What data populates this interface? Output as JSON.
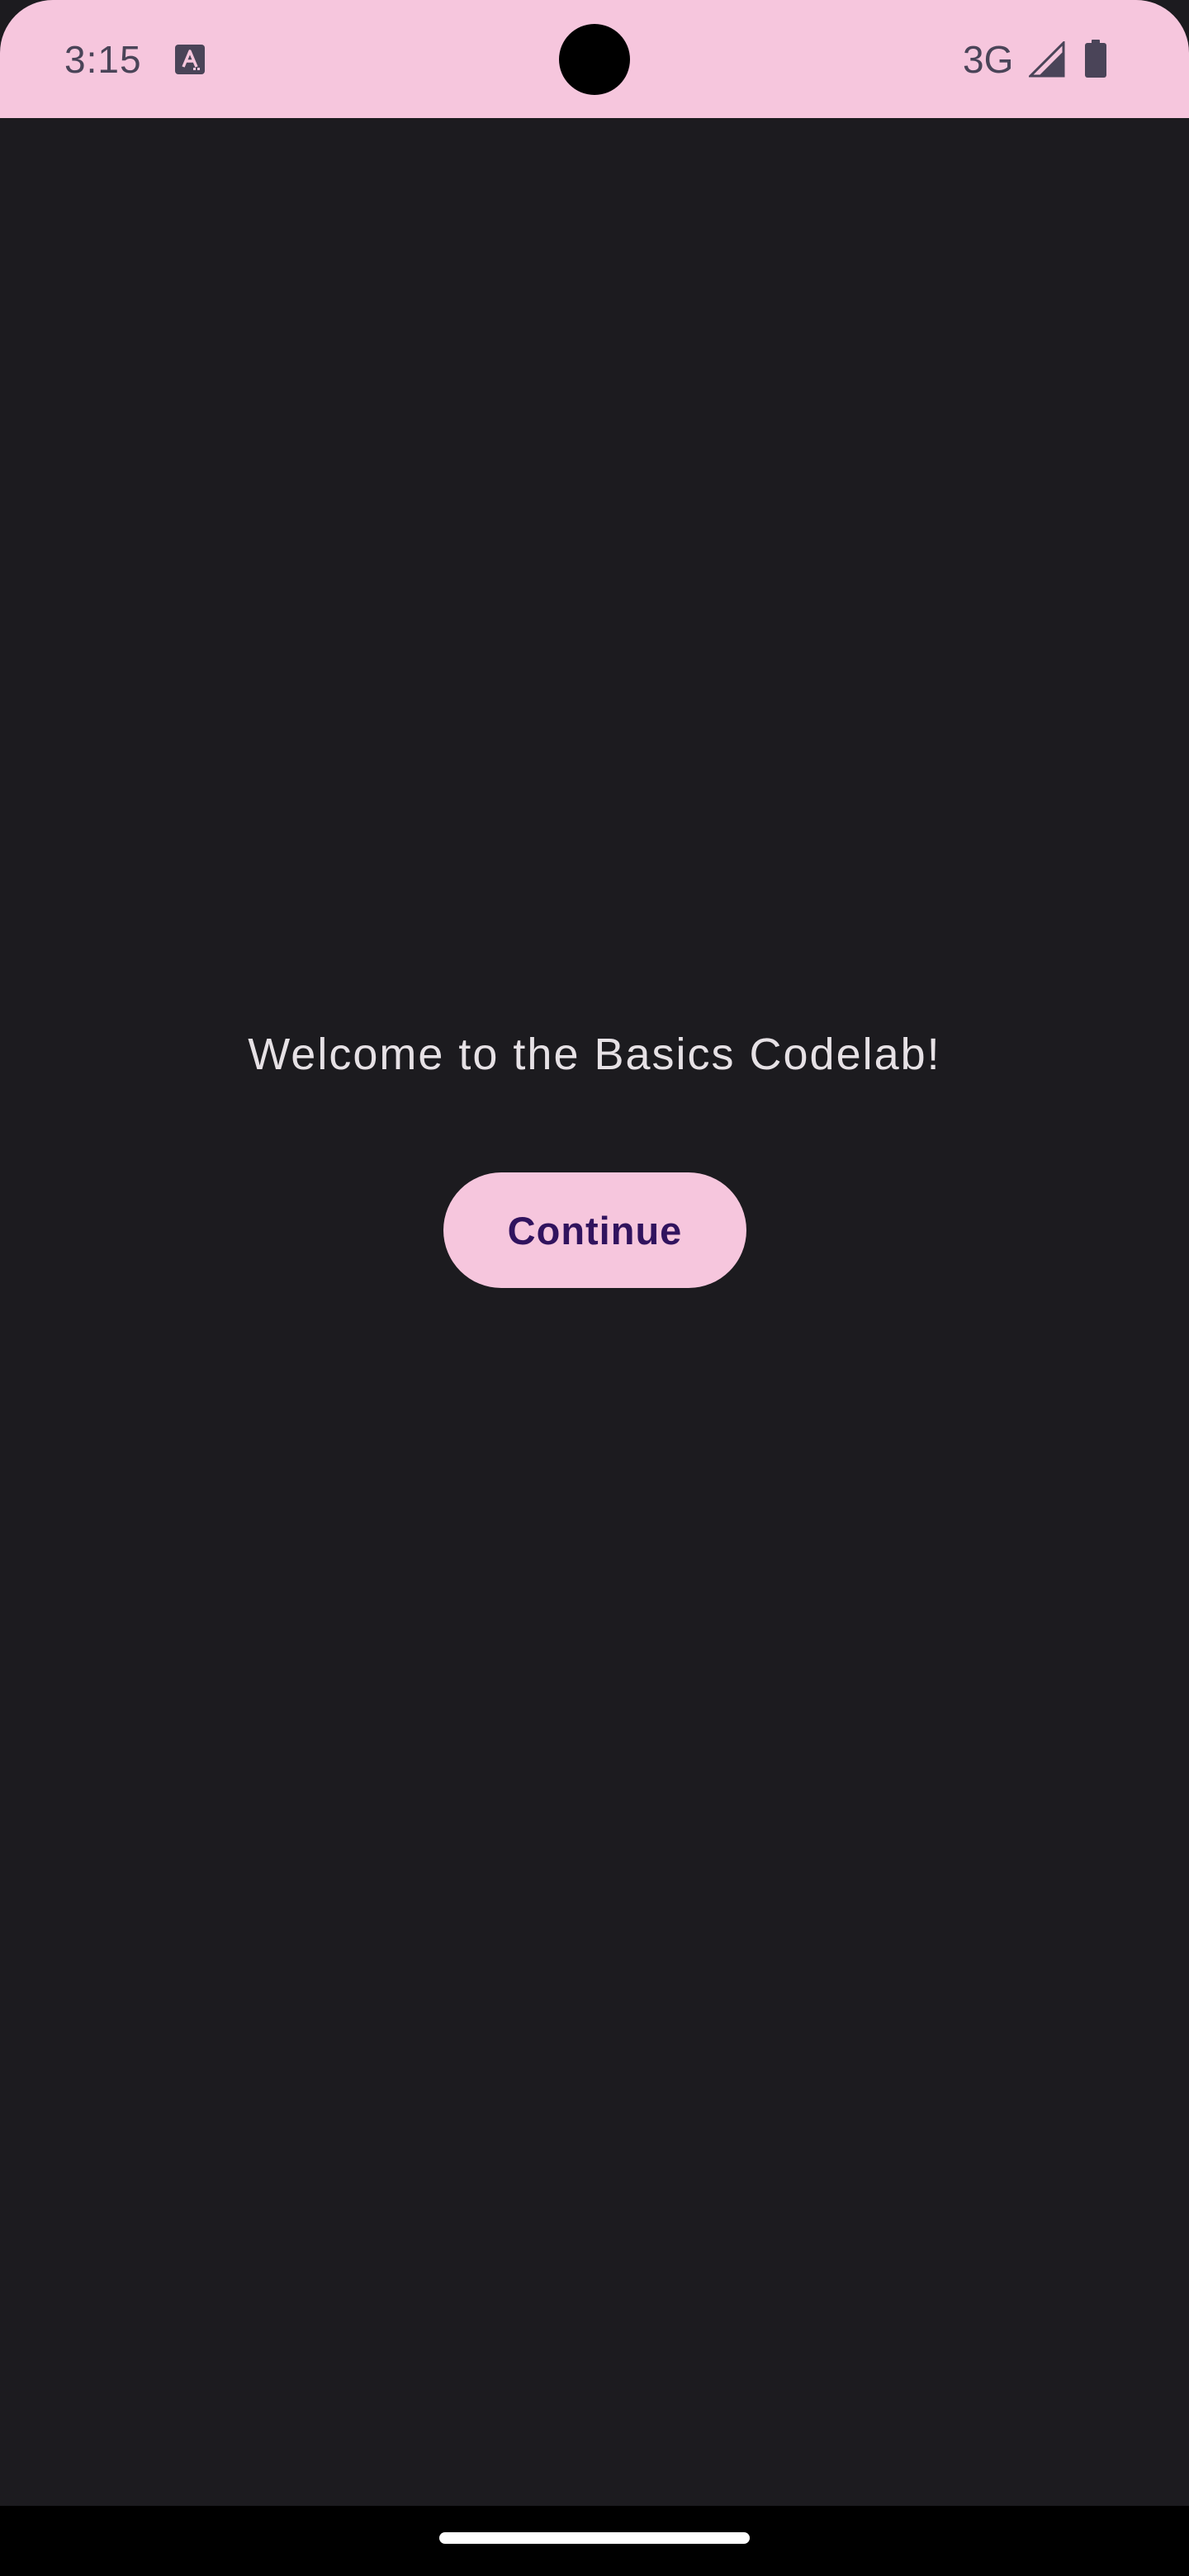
{
  "status_bar": {
    "time": "3:15",
    "network_type": "3G",
    "background_color": "#f6c6dd",
    "icons": [
      "text-notification-icon",
      "cellular-signal-icon",
      "battery-icon"
    ]
  },
  "main": {
    "welcome_text": "Welcome to the Basics Codelab!",
    "continue_label": "Continue",
    "background_color": "#1c1b1f",
    "button_color": "#f6c6dd",
    "button_text_color": "#31135e"
  },
  "nav_bar": {
    "type": "gesture-handle"
  }
}
